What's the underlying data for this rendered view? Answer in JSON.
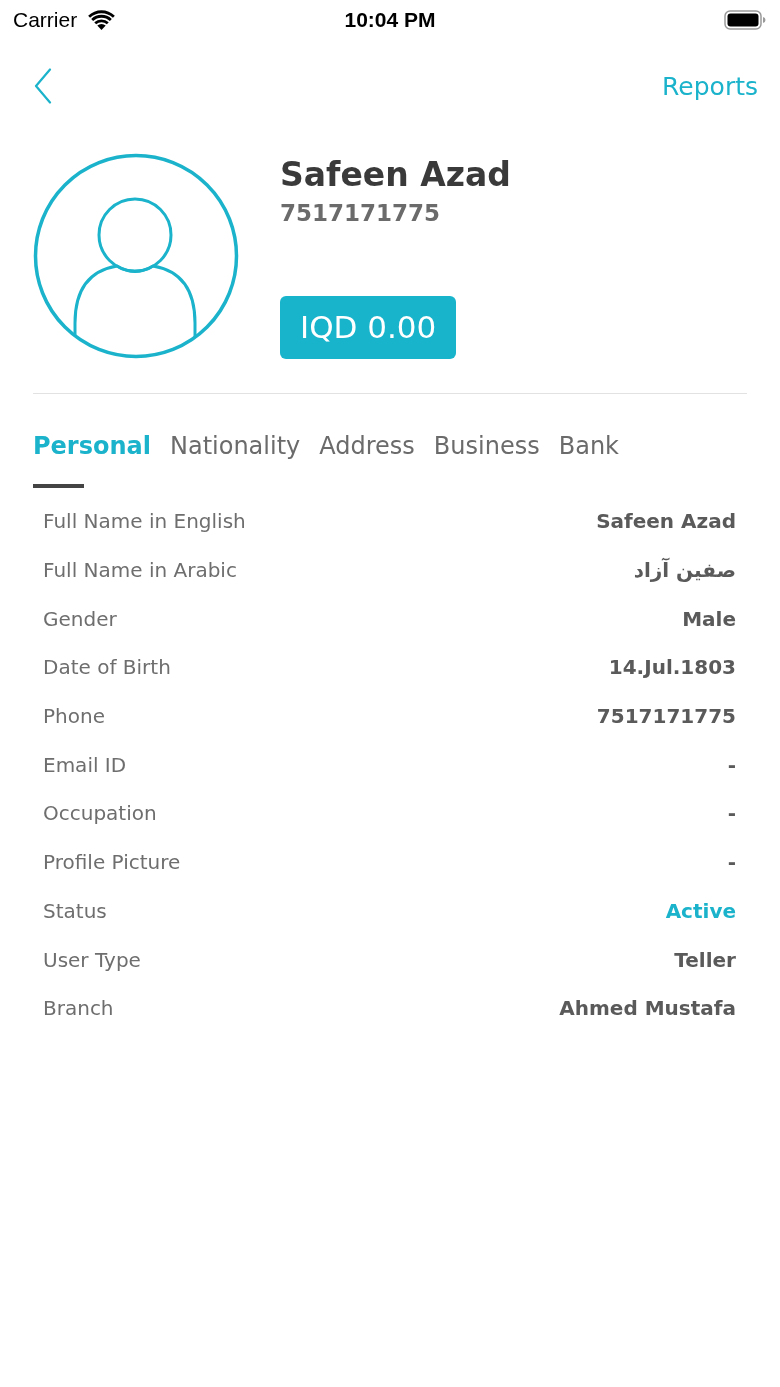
{
  "status_bar": {
    "carrier": "Carrier",
    "time": "10:04 PM"
  },
  "nav": {
    "action": "Reports"
  },
  "profile": {
    "name": "Safeen Azad",
    "phone": "7517171775",
    "balance": "IQD 0.00"
  },
  "tabs": [
    {
      "label": "Personal",
      "selected": true
    },
    {
      "label": "Nationality",
      "selected": false
    },
    {
      "label": "Address",
      "selected": false
    },
    {
      "label": "Business",
      "selected": false
    },
    {
      "label": "Bank",
      "selected": false
    }
  ],
  "fields": [
    {
      "label": "Full Name in English",
      "value": "Safeen Azad",
      "kind": "text"
    },
    {
      "label": "Full Name in Arabic",
      "value": "صفين آزاد",
      "kind": "text"
    },
    {
      "label": "Gender",
      "value": "Male",
      "kind": "text"
    },
    {
      "label": "Date of Birth",
      "value": "14.Jul.1803",
      "kind": "text"
    },
    {
      "label": "Phone",
      "value": "7517171775",
      "kind": "text"
    },
    {
      "label": "Email ID",
      "value": "-",
      "kind": "text"
    },
    {
      "label": "Occupation",
      "value": "-",
      "kind": "text"
    },
    {
      "label": "Profile Picture",
      "value": "-",
      "kind": "text"
    },
    {
      "label": "Status",
      "value": "Active",
      "kind": "status"
    },
    {
      "label": "User Type",
      "value": "Teller",
      "kind": "text"
    },
    {
      "label": "Branch",
      "value": "Ahmed Mustafa",
      "kind": "text"
    }
  ]
}
